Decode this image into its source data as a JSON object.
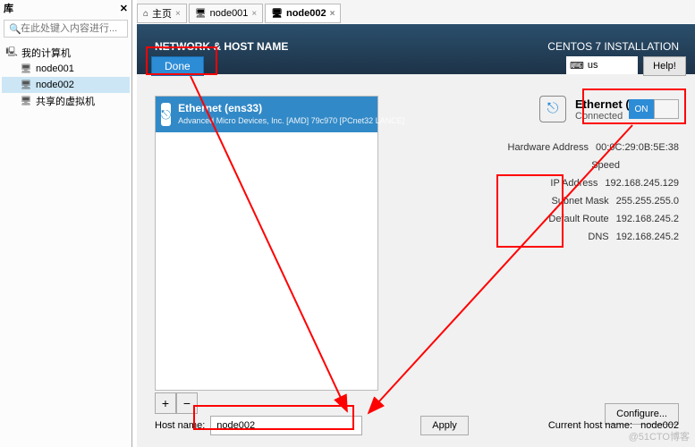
{
  "library": {
    "title": "库",
    "search_placeholder": "在此处键入内容进行...",
    "root": "我的计算机",
    "items": [
      "node001",
      "node002",
      "共享的虚拟机"
    ],
    "selected_index": 1
  },
  "tabs": [
    {
      "label": "主页",
      "icon": "⌂"
    },
    {
      "label": "node001",
      "icon": "🖥"
    },
    {
      "label": "node002",
      "icon": "🖥"
    }
  ],
  "active_tab": 2,
  "installer": {
    "section_title": "NETWORK & HOST NAME",
    "done": "Done",
    "product": "CENTOS 7 INSTALLATION",
    "keyboard": "us",
    "help": "Help!"
  },
  "nic": {
    "title": "Ethernet (ens33)",
    "vendor": "Advanced Micro Devices, Inc. [AMD] 79c970 [PCnet32 LANCE]",
    "plus": "+",
    "minus": "−"
  },
  "detail": {
    "title": "Ethernet (ens33)",
    "status": "Connected",
    "toggle": "ON",
    "props": [
      {
        "label": "Hardware Address",
        "value": "00:0C:29:0B:5E:38"
      },
      {
        "label": "Speed",
        "value": ""
      },
      {
        "label": "IP Address",
        "value": "192.168.245.129"
      },
      {
        "label": "Subnet Mask",
        "value": "255.255.255.0"
      },
      {
        "label": "Default Route",
        "value": "192.168.245.2"
      },
      {
        "label": "DNS",
        "value": "192.168.245.2"
      }
    ],
    "configure": "Configure..."
  },
  "hostname": {
    "label": "Host name:",
    "value": "node002",
    "apply": "Apply",
    "current_label": "Current host name:",
    "current_value": "node002"
  },
  "watermark": "@51CTO博客"
}
